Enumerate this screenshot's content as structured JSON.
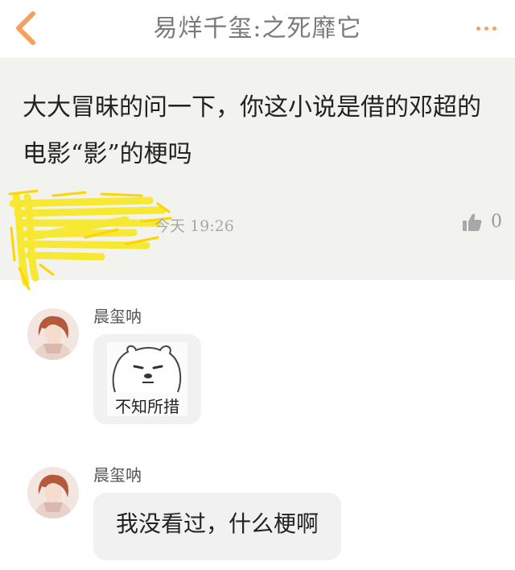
{
  "header": {
    "title": "易烊千玺:之死靡它",
    "back_icon": "chevron-left-icon",
    "more_icon": "more-dots-icon",
    "accent_color": "#f4a15c"
  },
  "post": {
    "text": "大大冒昧的问一下，你这小说是借的邓超的电影“影”的梗吗",
    "time": "今天 19:26",
    "likes": "0",
    "background_color": "#f2f2ee"
  },
  "messages": [
    {
      "sender": "晨玺呐",
      "type": "sticker",
      "sticker_text": "不知所措",
      "avatar_icon": "user-avatar"
    },
    {
      "sender": "晨玺呐",
      "type": "text",
      "text": "我没看过，什么梗啊",
      "avatar_icon": "user-avatar"
    }
  ]
}
